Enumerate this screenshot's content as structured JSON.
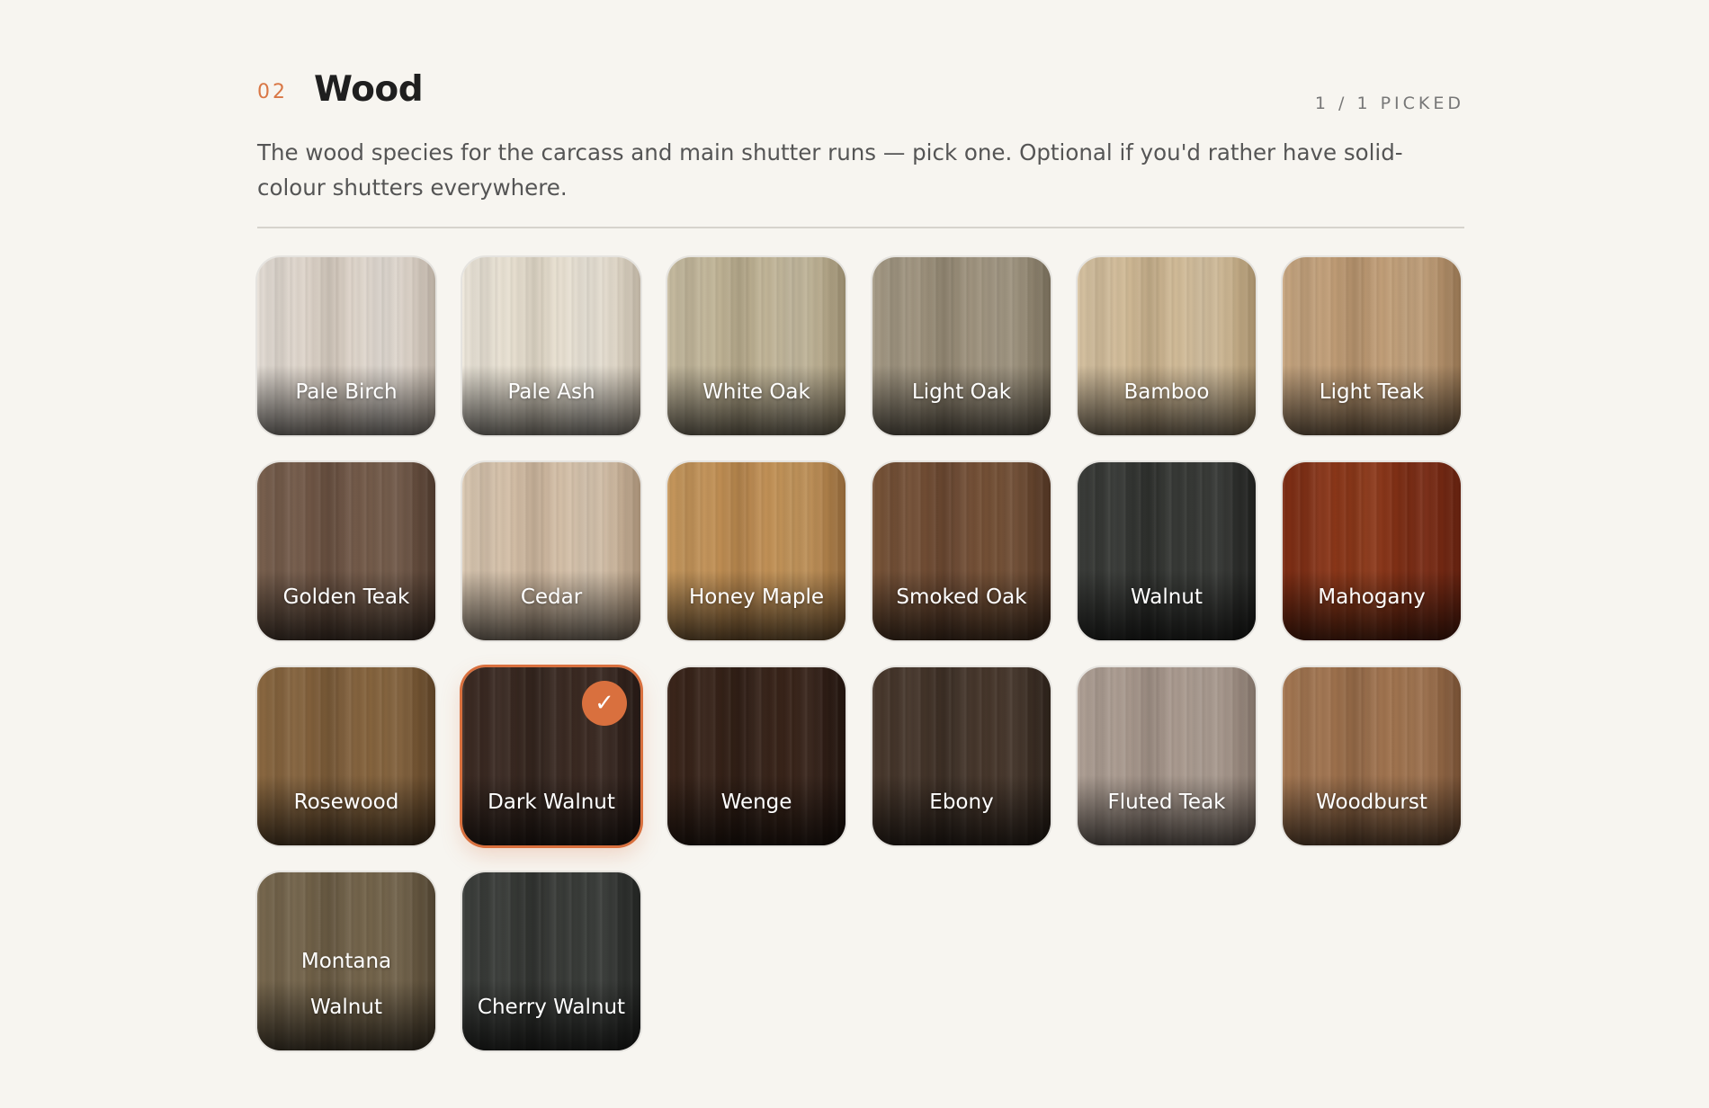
{
  "section": {
    "number": "02",
    "title": "Wood",
    "picked_count": "1 / 1 PICKED",
    "description": "The wood species for the carcass and main shutter runs — pick one. Optional if you'd rather have solid-colour shutters everywhere."
  },
  "accent_color": "#d9703e",
  "woods": [
    {
      "label": "Pale Birch",
      "colors": [
        "#e7e0d8",
        "#d6cbbf",
        "#c8bcaf"
      ],
      "selected": false
    },
    {
      "label": "Pale Ash",
      "colors": [
        "#eee8dc",
        "#e2d9c8",
        "#cdc2b0"
      ],
      "selected": false
    },
    {
      "label": "White Oak",
      "colors": [
        "#c9bea3",
        "#b8ab8c",
        "#a39576"
      ],
      "selected": false
    },
    {
      "label": "Light Oak",
      "colors": [
        "#a89d88",
        "#948873",
        "#7e735f"
      ],
      "selected": false
    },
    {
      "label": "Bamboo",
      "colors": [
        "#d9c5a4",
        "#c8b08b",
        "#b39a73"
      ],
      "selected": false
    },
    {
      "label": "Light Teak",
      "colors": [
        "#c9a882",
        "#b8946d",
        "#a07d58"
      ],
      "selected": false
    },
    {
      "label": "Golden Teak",
      "colors": [
        "#7b6250",
        "#684f3f",
        "#533d30"
      ],
      "selected": false
    },
    {
      "label": "Cedar",
      "colors": [
        "#dccab4",
        "#ccb59c",
        "#b49b80"
      ],
      "selected": false
    },
    {
      "label": "Honey Maple",
      "colors": [
        "#c99a5e",
        "#b8864c",
        "#9c6f3d"
      ],
      "selected": false
    },
    {
      "label": "Smoked Oak",
      "colors": [
        "#7a5539",
        "#6a4730",
        "#553825"
      ],
      "selected": false
    },
    {
      "label": "Walnut",
      "colors": [
        "#3b3d3a",
        "#2e302d",
        "#222321"
      ],
      "selected": false
    },
    {
      "label": "Mahogany",
      "colors": [
        "#7e2d14",
        "#8f3a1a",
        "#6b2411"
      ],
      "selected": false
    },
    {
      "label": "Rosewood",
      "colors": [
        "#8d6a42",
        "#7a5a37",
        "#634729"
      ],
      "selected": false
    },
    {
      "label": "Dark Walnut",
      "colors": [
        "#3e2c24",
        "#33241d",
        "#281b16"
      ],
      "selected": true
    },
    {
      "label": "Wenge",
      "colors": [
        "#3c261b",
        "#301e15",
        "#241610"
      ],
      "selected": false
    },
    {
      "label": "Ebony",
      "colors": [
        "#4b3a2e",
        "#3d2f25",
        "#2f241c"
      ],
      "selected": false
    },
    {
      "label": "Fluted Teak",
      "colors": [
        "#b2a398",
        "#a09085",
        "#8b7b70"
      ],
      "selected": false
    },
    {
      "label": "Woodburst",
      "colors": [
        "#a87a54",
        "#966a47",
        "#7e5638"
      ],
      "selected": false
    },
    {
      "label": "Montana Walnut",
      "colors": [
        "#7a6a50",
        "#6a5b43",
        "#564935"
      ],
      "selected": false
    },
    {
      "label": "Cherry Walnut",
      "colors": [
        "#3d403d",
        "#313330",
        "#252725"
      ],
      "selected": false
    }
  ]
}
